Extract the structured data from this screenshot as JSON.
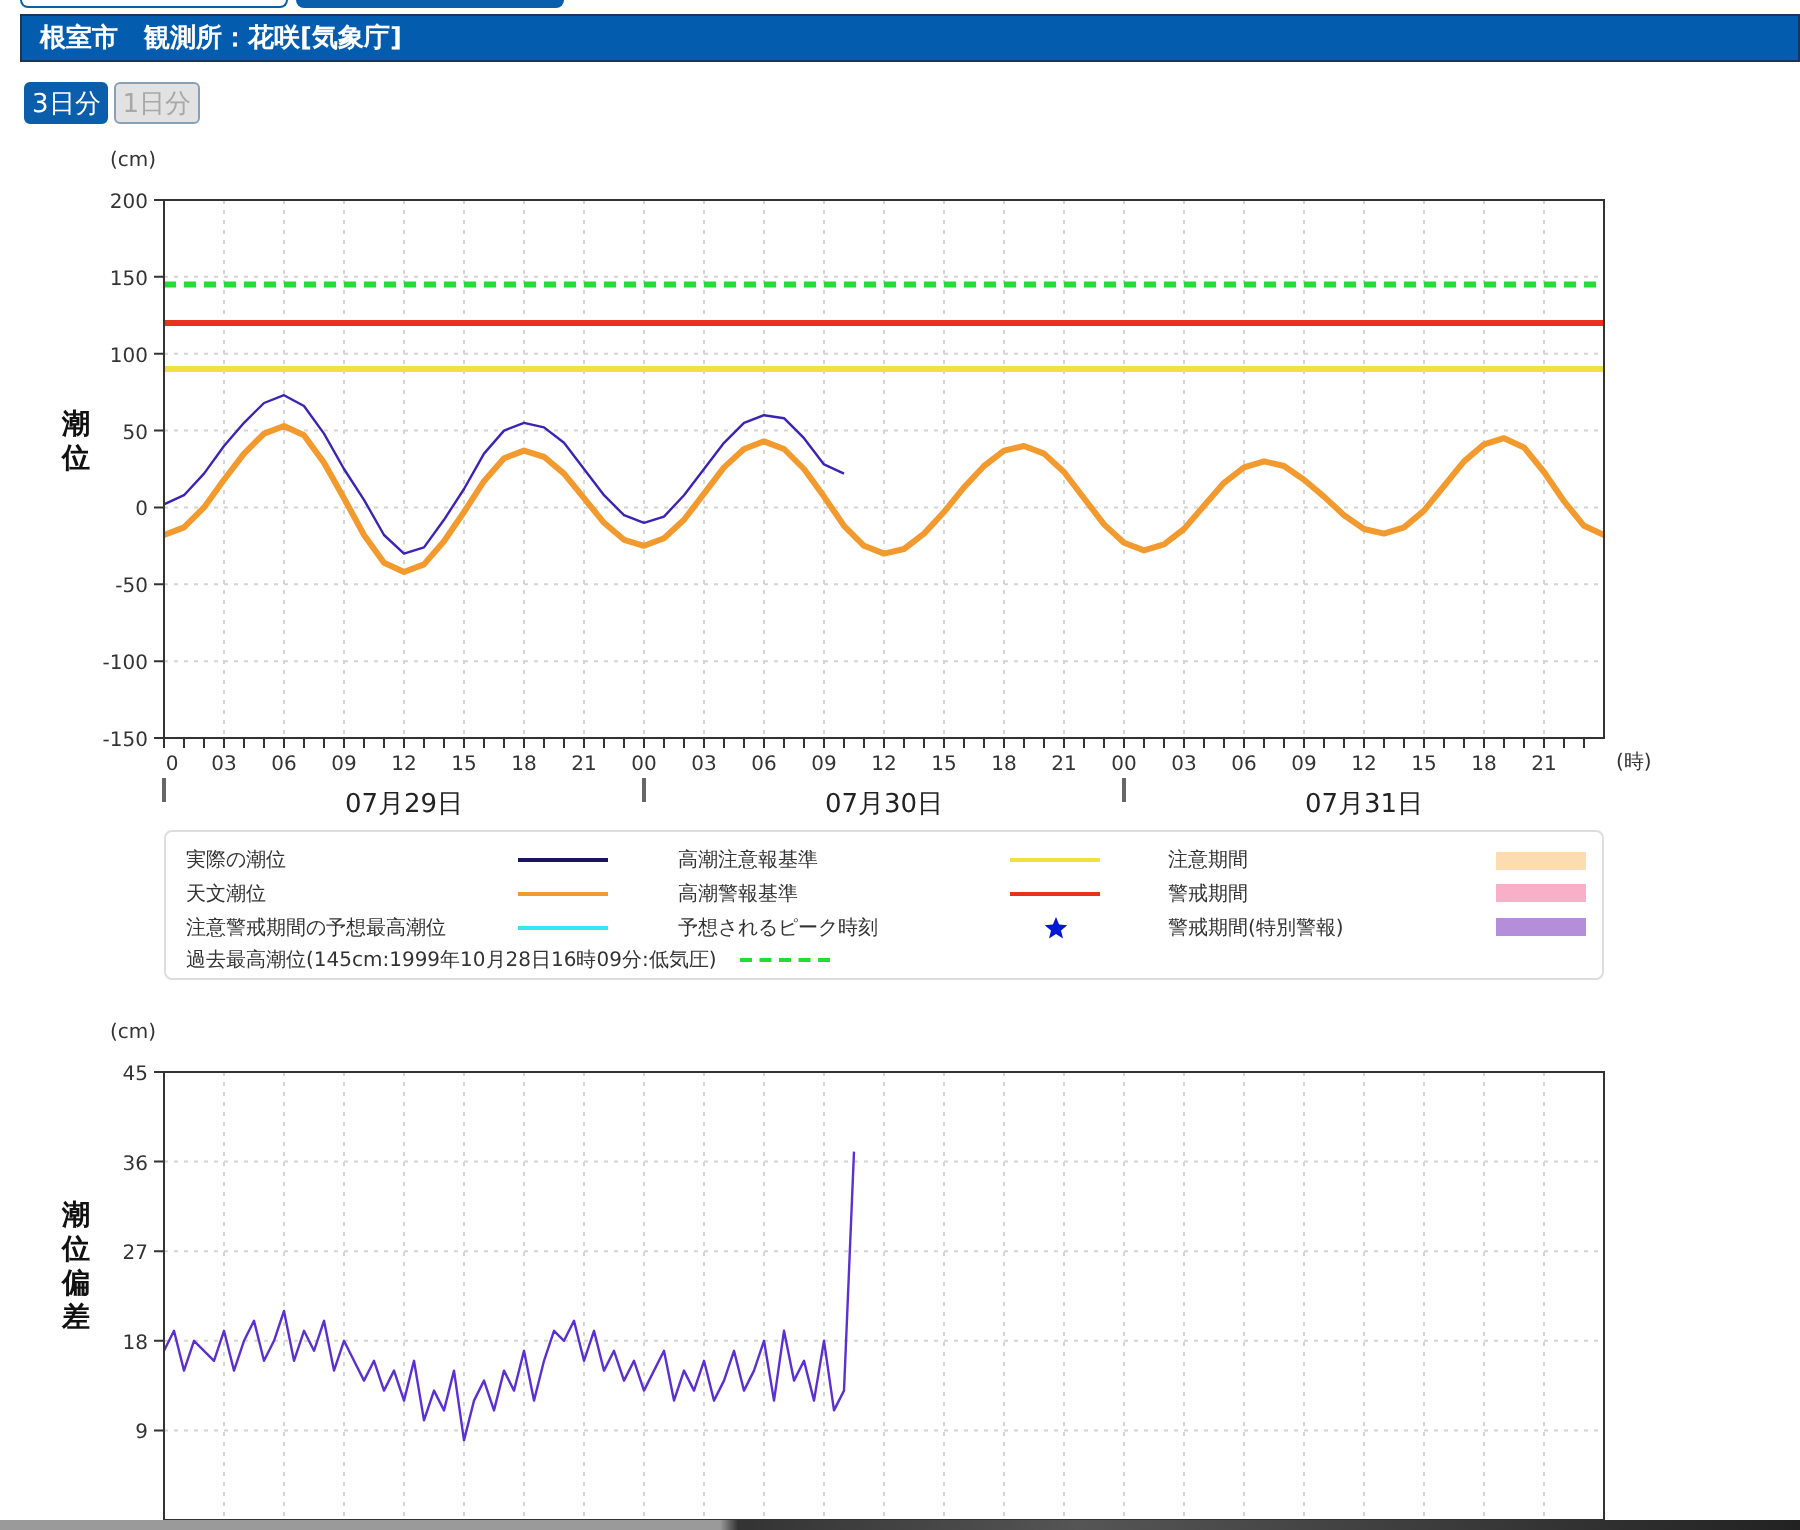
{
  "top_tabs": [
    {
      "selected": false
    },
    {
      "selected": true
    }
  ],
  "header": {
    "title": "根室市　観測所：花咲[気象庁]"
  },
  "range_buttons": [
    {
      "label": "3日分",
      "selected": true
    },
    {
      "label": "1日分",
      "selected": false
    }
  ],
  "tide_chart": {
    "y_unit": "(cm)",
    "x_unit": "(時)",
    "day_labels": [
      "07月29日",
      "07月30日",
      "07月31日"
    ],
    "chart_data": {
      "type": "line",
      "ylabel": "潮位",
      "grid": true,
      "categories": [
        "0",
        null,
        null,
        "03",
        null,
        null,
        "06",
        null,
        null,
        "09",
        null,
        null,
        "12",
        null,
        null,
        "15",
        null,
        null,
        "18",
        null,
        null,
        "21",
        null,
        null,
        "00",
        null,
        null,
        "03",
        null,
        null,
        "06",
        null,
        null,
        "09",
        null,
        null,
        "12",
        null,
        null,
        "15",
        null,
        null,
        "18",
        null,
        null,
        "21",
        null,
        null,
        "00",
        null,
        null,
        "03",
        null,
        null,
        "06",
        null,
        null,
        "09",
        null,
        null,
        "12",
        null,
        null,
        "15",
        null,
        null,
        "18",
        null,
        null,
        "21",
        null,
        null,
        null
      ],
      "ylim": [
        -150,
        200
      ],
      "yticks": [
        200,
        150,
        100,
        50,
        0,
        -50,
        -100,
        -150
      ],
      "series": [
        {
          "color": "#f39a2e",
          "values": [
            -18,
            -13,
            0,
            18,
            35,
            48,
            53,
            47,
            29,
            6,
            -18,
            -36,
            -42,
            -37,
            -22,
            -3,
            17,
            32,
            37,
            33,
            22,
            6,
            -10,
            -21,
            -25,
            -20,
            -8,
            9,
            26,
            38,
            43,
            38,
            25,
            7,
            -12,
            -25,
            -30,
            -27,
            -17,
            -3,
            13,
            27,
            37,
            40,
            35,
            23,
            6,
            -11,
            -23,
            -28,
            -24,
            -14,
            1,
            16,
            26,
            30,
            27,
            18,
            7,
            -5,
            -14,
            -17,
            -13,
            -2,
            14,
            30,
            41,
            45,
            39,
            23,
            4,
            -12,
            -18
          ]
        },
        {
          "color": "#3d22b8",
          "values": [
            2,
            8,
            22,
            40,
            55,
            68,
            73,
            66,
            48,
            25,
            5,
            -18,
            -30,
            -26,
            -8,
            12,
            35,
            50,
            55,
            52,
            42,
            25,
            8,
            -5,
            -10,
            -6,
            8,
            25,
            42,
            55,
            60,
            58,
            45,
            28,
            22,
            null,
            null,
            null,
            null,
            null,
            null,
            null,
            null,
            null,
            null,
            null,
            null,
            null,
            null,
            null,
            null,
            null,
            null,
            null,
            null,
            null,
            null,
            null,
            null,
            null,
            null,
            null,
            null,
            null,
            null,
            null,
            null,
            null,
            null,
            null,
            null,
            null,
            null
          ]
        }
      ],
      "ref_lines": [
        {
          "axis": "y",
          "value": 145,
          "color": "#22dd33"
        },
        {
          "axis": "y",
          "value": 120,
          "color": "#e8321e"
        },
        {
          "axis": "y",
          "value": 90,
          "color": "#f0e040"
        }
      ]
    }
  },
  "legend": [
    {
      "label": "実際の潮位",
      "kind": "line",
      "color": "#1b1464"
    },
    {
      "label": "高潮注意報基準",
      "kind": "line",
      "color": "#f0e040"
    },
    {
      "label": "注意期間",
      "kind": "band",
      "color": "#fcdcb0"
    },
    {
      "label": "天文潮位",
      "kind": "line",
      "color": "#f39a2e"
    },
    {
      "label": "高潮警報基準",
      "kind": "line",
      "color": "#e8321e"
    },
    {
      "label": "警戒期間",
      "kind": "band",
      "color": "#f8b0c8"
    },
    {
      "label": "注意警戒期間の予想最高潮位",
      "kind": "line",
      "color": "#33e6f0"
    },
    {
      "label": "予想されるピーク時刻",
      "kind": "star",
      "color": "#0018d8"
    },
    {
      "label": "警戒期間(特別警報)",
      "kind": "band",
      "color": "#b48ed8"
    },
    {
      "label": "過去最高潮位(145cm:1999年10月28日16時09分:低気圧)",
      "kind": "dashed",
      "color": "#22dd33"
    }
  ],
  "deviation_chart": {
    "y_unit": "(cm)",
    "chart_data": {
      "type": "line",
      "ylabel": "潮位偏差",
      "grid": true,
      "ylim": [
        0,
        45
      ],
      "yticks": [
        45,
        36,
        27,
        18,
        9
      ],
      "categories": [
        null,
        null,
        null,
        null,
        null,
        null,
        null,
        null,
        null,
        null,
        null,
        null,
        null,
        null,
        null,
        null,
        null,
        null,
        null,
        null,
        null,
        null,
        null,
        null,
        null,
        null,
        null,
        null,
        null,
        null,
        null,
        null,
        null,
        null,
        null,
        null,
        null,
        null,
        null,
        null,
        null,
        null,
        null,
        null,
        null,
        null,
        null,
        null,
        null,
        null,
        null,
        null,
        null,
        null,
        null,
        null,
        null,
        null,
        null,
        null,
        null,
        null,
        null,
        null,
        null,
        null,
        null,
        null,
        null,
        null,
        null,
        null,
        null,
        null,
        null,
        null,
        null,
        null,
        null,
        null,
        null,
        null,
        null,
        null,
        null,
        null,
        null,
        null,
        null,
        null,
        null,
        null,
        null,
        null,
        null,
        null,
        null,
        null,
        null,
        null,
        null,
        null,
        null,
        null,
        null,
        null,
        null,
        null,
        null,
        null,
        null,
        null,
        null,
        null,
        null,
        null,
        null,
        null,
        null,
        null,
        null,
        null,
        null,
        null,
        null,
        null,
        null,
        null,
        null,
        null,
        null,
        null,
        null,
        null,
        null,
        null,
        null,
        null,
        null,
        null,
        null,
        null,
        null,
        null,
        null
      ],
      "series": [
        {
          "color": "#5a30d0",
          "values": [
            17,
            19,
            15,
            18,
            17,
            16,
            19,
            15,
            18,
            20,
            16,
            18,
            21,
            16,
            19,
            17,
            20,
            15,
            18,
            16,
            14,
            16,
            13,
            15,
            12,
            16,
            10,
            13,
            11,
            15,
            8,
            12,
            14,
            11,
            15,
            13,
            17,
            12,
            16,
            19,
            18,
            20,
            16,
            19,
            15,
            17,
            14,
            16,
            13,
            15,
            17,
            12,
            15,
            13,
            16,
            12,
            14,
            17,
            13,
            15,
            18,
            12,
            19,
            14,
            16,
            12,
            18,
            11,
            13,
            37,
            null,
            null,
            null,
            null,
            null,
            null,
            null,
            null,
            null,
            null,
            null,
            null,
            null,
            null,
            null,
            null,
            null,
            null,
            null,
            null,
            null,
            null,
            null,
            null,
            null,
            null,
            null,
            null,
            null,
            null,
            null,
            null,
            null,
            null,
            null,
            null,
            null,
            null,
            null,
            null,
            null,
            null,
            null,
            null,
            null,
            null,
            null,
            null,
            null,
            null,
            null,
            null,
            null,
            null,
            null,
            null,
            null,
            null,
            null,
            null,
            null,
            null,
            null,
            null,
            null,
            null,
            null,
            null,
            null,
            null,
            null,
            null,
            null,
            null,
            null
          ]
        }
      ]
    }
  }
}
